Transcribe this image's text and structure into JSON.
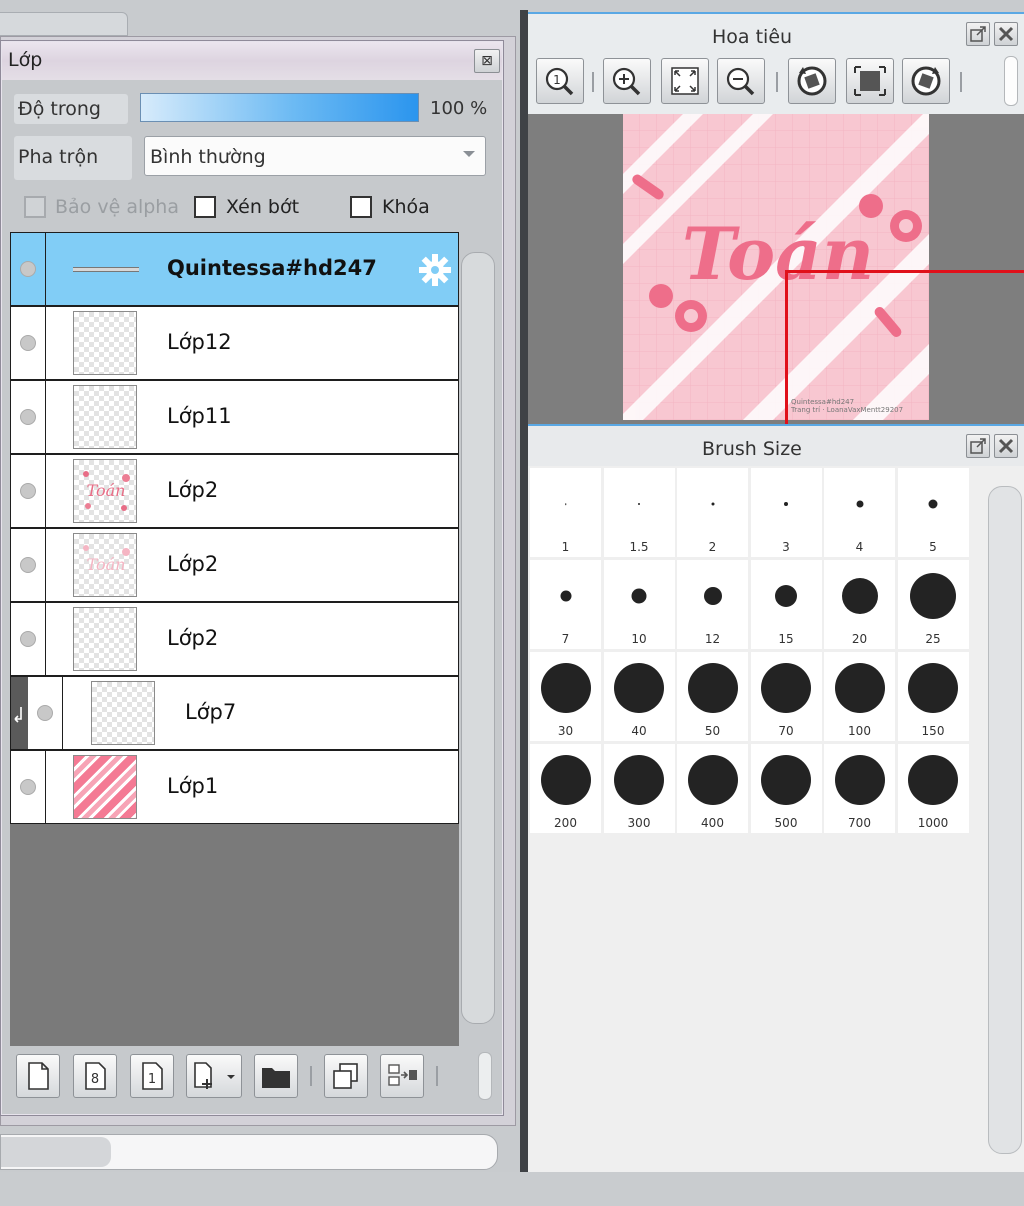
{
  "layer_panel": {
    "title": "Lớp",
    "close_glyph": "⊠",
    "opacity_label": "Độ trong",
    "opacity_value": "100 %",
    "opacity_fraction": 1.0,
    "blend_label": "Pha trộn",
    "blend_value": "Bình thường",
    "checkboxes": [
      {
        "label": "Bảo vệ alpha",
        "checked": false,
        "enabled": false
      },
      {
        "label": "Xén bớt",
        "checked": false,
        "enabled": true
      },
      {
        "label": "Khóa",
        "checked": false,
        "enabled": true
      }
    ],
    "layers": [
      {
        "name": "Quintessa#hd247",
        "selected": true,
        "type": "text"
      },
      {
        "name": "Lớp12",
        "selected": false,
        "type": "empty"
      },
      {
        "name": "Lớp11",
        "selected": false,
        "type": "empty"
      },
      {
        "name": "Lớp2",
        "selected": false,
        "type": "art"
      },
      {
        "name": "Lớp2",
        "selected": false,
        "type": "art-faded"
      },
      {
        "name": "Lớp2",
        "selected": false,
        "type": "empty"
      },
      {
        "name": "Lớp7",
        "selected": false,
        "type": "clipped"
      },
      {
        "name": "Lớp1",
        "selected": false,
        "type": "stripes"
      }
    ],
    "toolbar_icons": [
      "new-layer-icon",
      "new-8bit-layer-icon",
      "new-1bit-layer-icon",
      "new-layer-menu-icon",
      "new-folder-icon",
      "duplicate-layer-icon",
      "merge-layer-icon"
    ]
  },
  "navigator": {
    "title": "Hoa tiêu",
    "buttons": [
      "zoom-actual-icon",
      "zoom-in-icon",
      "fit-window-icon",
      "zoom-out-icon",
      "rotate-left-icon",
      "fit-canvas-icon",
      "rotate-right-icon"
    ]
  },
  "brush_size": {
    "title": "Brush Size",
    "sizes": [
      "1",
      "1.5",
      "2",
      "3",
      "4",
      "5",
      "7",
      "10",
      "12",
      "15",
      "20",
      "25",
      "30",
      "40",
      "50",
      "70",
      "100",
      "150",
      "200",
      "300",
      "400",
      "500",
      "700",
      "1000"
    ]
  },
  "colors": {
    "selection": "#81cdf6",
    "accent_blue": "#2b95ee",
    "canvas_pink": "#f8c7d1",
    "nav_frame": "#e0101a"
  }
}
